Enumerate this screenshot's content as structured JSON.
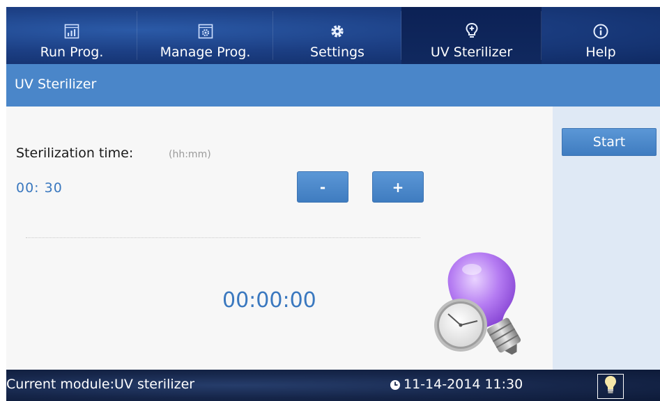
{
  "nav": {
    "tabs": [
      {
        "label": "Run Prog.",
        "icon": "bar-chart-icon",
        "active": false
      },
      {
        "label": "Manage Prog.",
        "icon": "manage-program-icon",
        "active": false
      },
      {
        "label": "Settings",
        "icon": "gear-icon",
        "active": false
      },
      {
        "label": "UV Sterilizer",
        "icon": "uv-bulb-icon",
        "active": true
      },
      {
        "label": "Help",
        "icon": "info-icon",
        "active": false
      }
    ]
  },
  "title": "UV Sterilizer",
  "sterilization": {
    "label": "Sterilization time:",
    "unit_hint": "(hh:mm)",
    "value": "00: 30",
    "minus_label": "-",
    "plus_label": "+"
  },
  "countdown": "00:00:00",
  "actions": {
    "start_label": "Start"
  },
  "status": {
    "module_text": "Current module:UV sterilizer",
    "datetime": "11-14-2014 11:30"
  },
  "colors": {
    "accent": "#4a86c9",
    "nav_bg": "#1c3f84",
    "status_bg": "#16264a",
    "value_text": "#3a78bf"
  }
}
